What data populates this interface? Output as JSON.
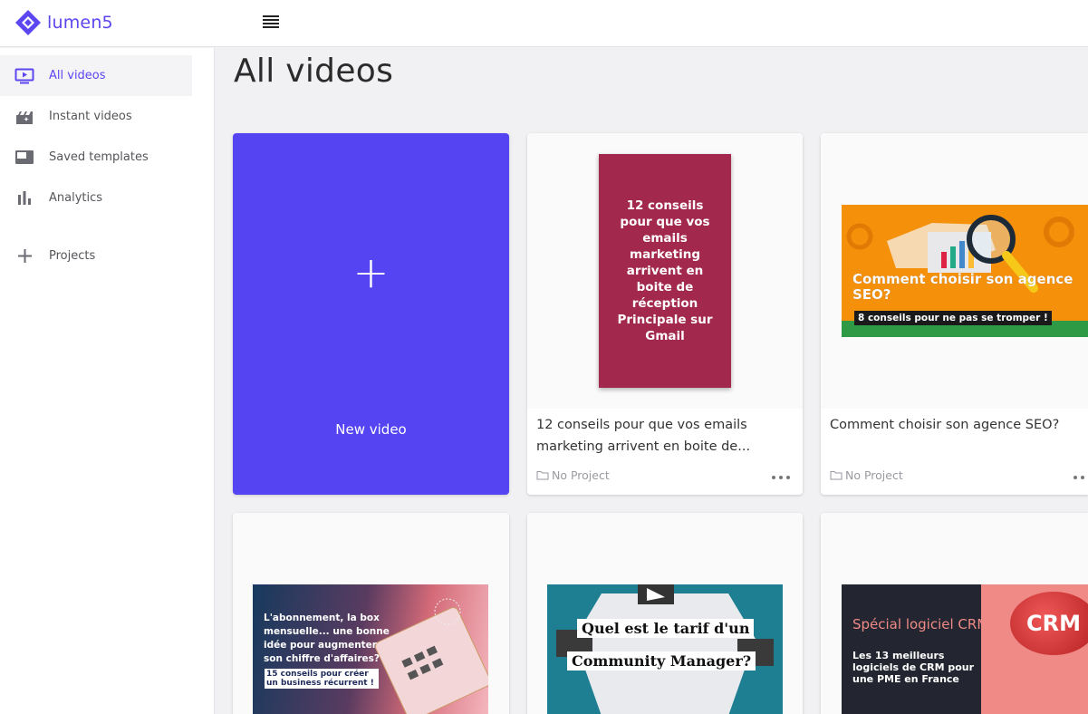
{
  "app": {
    "name": "lumen5",
    "brand_color": "#5b46f0"
  },
  "header": {
    "menu_icon": "hamburger-icon"
  },
  "sidebar": {
    "items": [
      {
        "label": "All videos",
        "icon": "play-screen-icon",
        "active": true
      },
      {
        "label": "Instant videos",
        "icon": "clapperboard-icon",
        "active": false
      },
      {
        "label": "Saved templates",
        "icon": "template-icon",
        "active": false
      },
      {
        "label": "Analytics",
        "icon": "bar-chart-icon",
        "active": false
      },
      {
        "label": "Projects",
        "icon": "plus-icon",
        "active": false
      }
    ]
  },
  "main": {
    "title": "All videos",
    "new_video": {
      "plus": "+",
      "label": "New video",
      "color": "#5444f2"
    },
    "videos": [
      {
        "title": "12 conseils pour que vos emails marketing arrivent en boite de...",
        "project": "No Project",
        "thumb_text": "12 conseils pour que vos emails marketing arrivent en boite de réception Principale sur Gmail",
        "thumb_color": "#a2284d"
      },
      {
        "title": "Comment choisir son agence SEO?",
        "project": "No Project",
        "thumb_title": "Comment choisir son agence SEO?",
        "thumb_sub": "8 conseils pour ne pas se tromper !",
        "thumb_color": "#f5900b"
      },
      {
        "thumb_title": "L'abonnement, la box mensuelle... une bonne idée pour augmenter son chiffre d'affaires?",
        "thumb_sub": "15 conseils pour créer un business récurrent !"
      },
      {
        "thumb_line1": "Quel est le tarif d'un",
        "thumb_line2": "Community Manager?"
      },
      {
        "thumb_title": "Spécial logiciel CRM",
        "thumb_sub": "Les 13 meilleurs logiciels de CRM pour une PME en France",
        "thumb_badge": "CRM"
      }
    ]
  }
}
